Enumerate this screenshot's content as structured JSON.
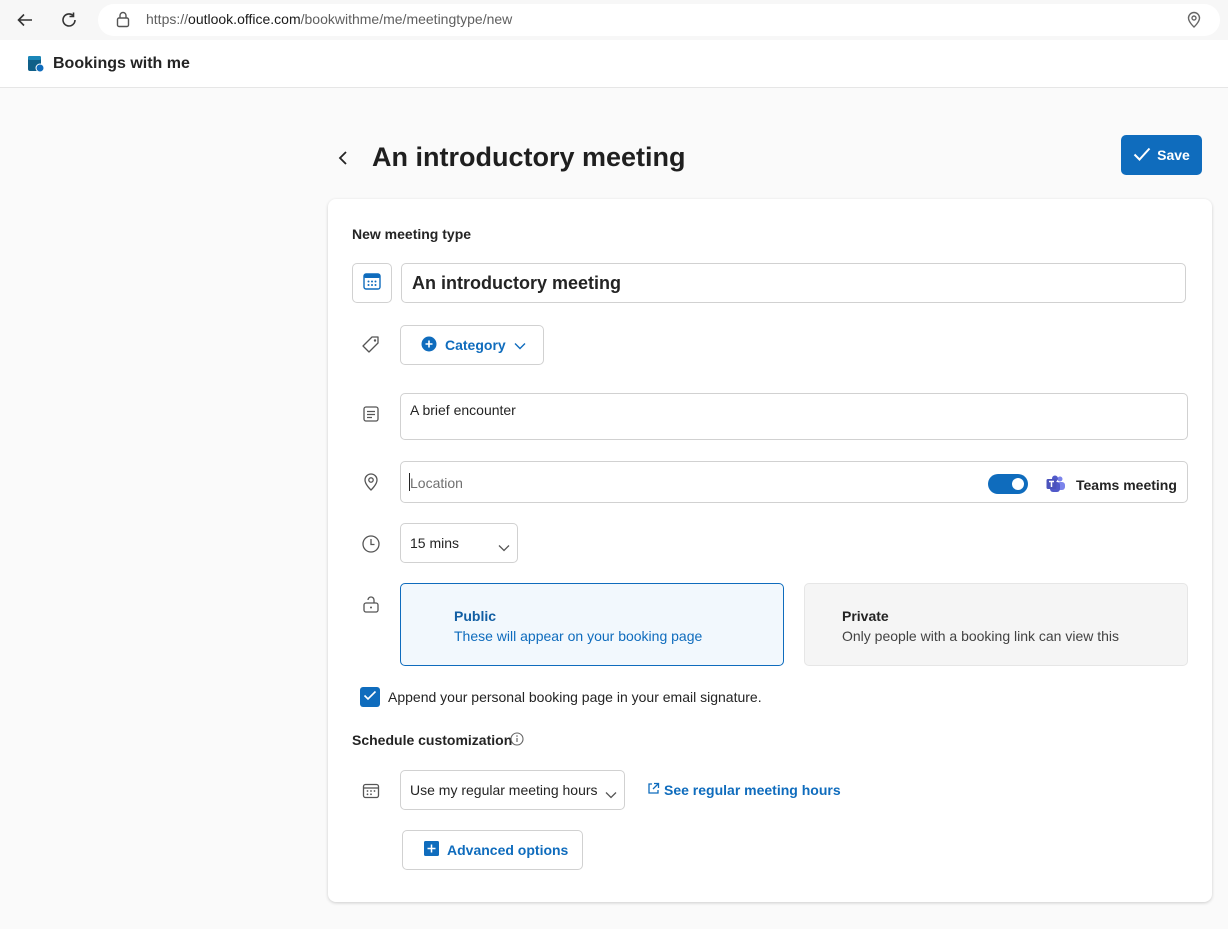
{
  "browser": {
    "url_prefix": "https://",
    "url_host": "outlook.office.com",
    "url_path": "/bookwithme/me/meetingtype/new"
  },
  "app": {
    "title": "Bookings with me"
  },
  "page": {
    "title": "An introductory meeting",
    "save_label": "Save"
  },
  "form": {
    "section_label": "New meeting type",
    "name_value": "An introductory meeting",
    "category_label": "Category",
    "description_value": "A brief encounter",
    "location_placeholder": "Location",
    "teams_toggle_on": true,
    "teams_label": "Teams meeting",
    "duration_value": "15 mins",
    "visibility": {
      "selected": "public",
      "public_title": "Public",
      "public_sub": "These will appear on your booking page",
      "private_title": "Private",
      "private_sub": "Only people with a booking link can view this"
    },
    "append_signature_checked": true,
    "append_signature_label": "Append your personal booking page in your email signature."
  },
  "schedule": {
    "label": "Schedule customization",
    "hours_value": "Use my regular meeting hours",
    "see_hours_link": "See regular meeting hours",
    "advanced_label": "Advanced options"
  },
  "colors": {
    "accent": "#0f6cbd",
    "public_bg": "#f2f8fd"
  }
}
